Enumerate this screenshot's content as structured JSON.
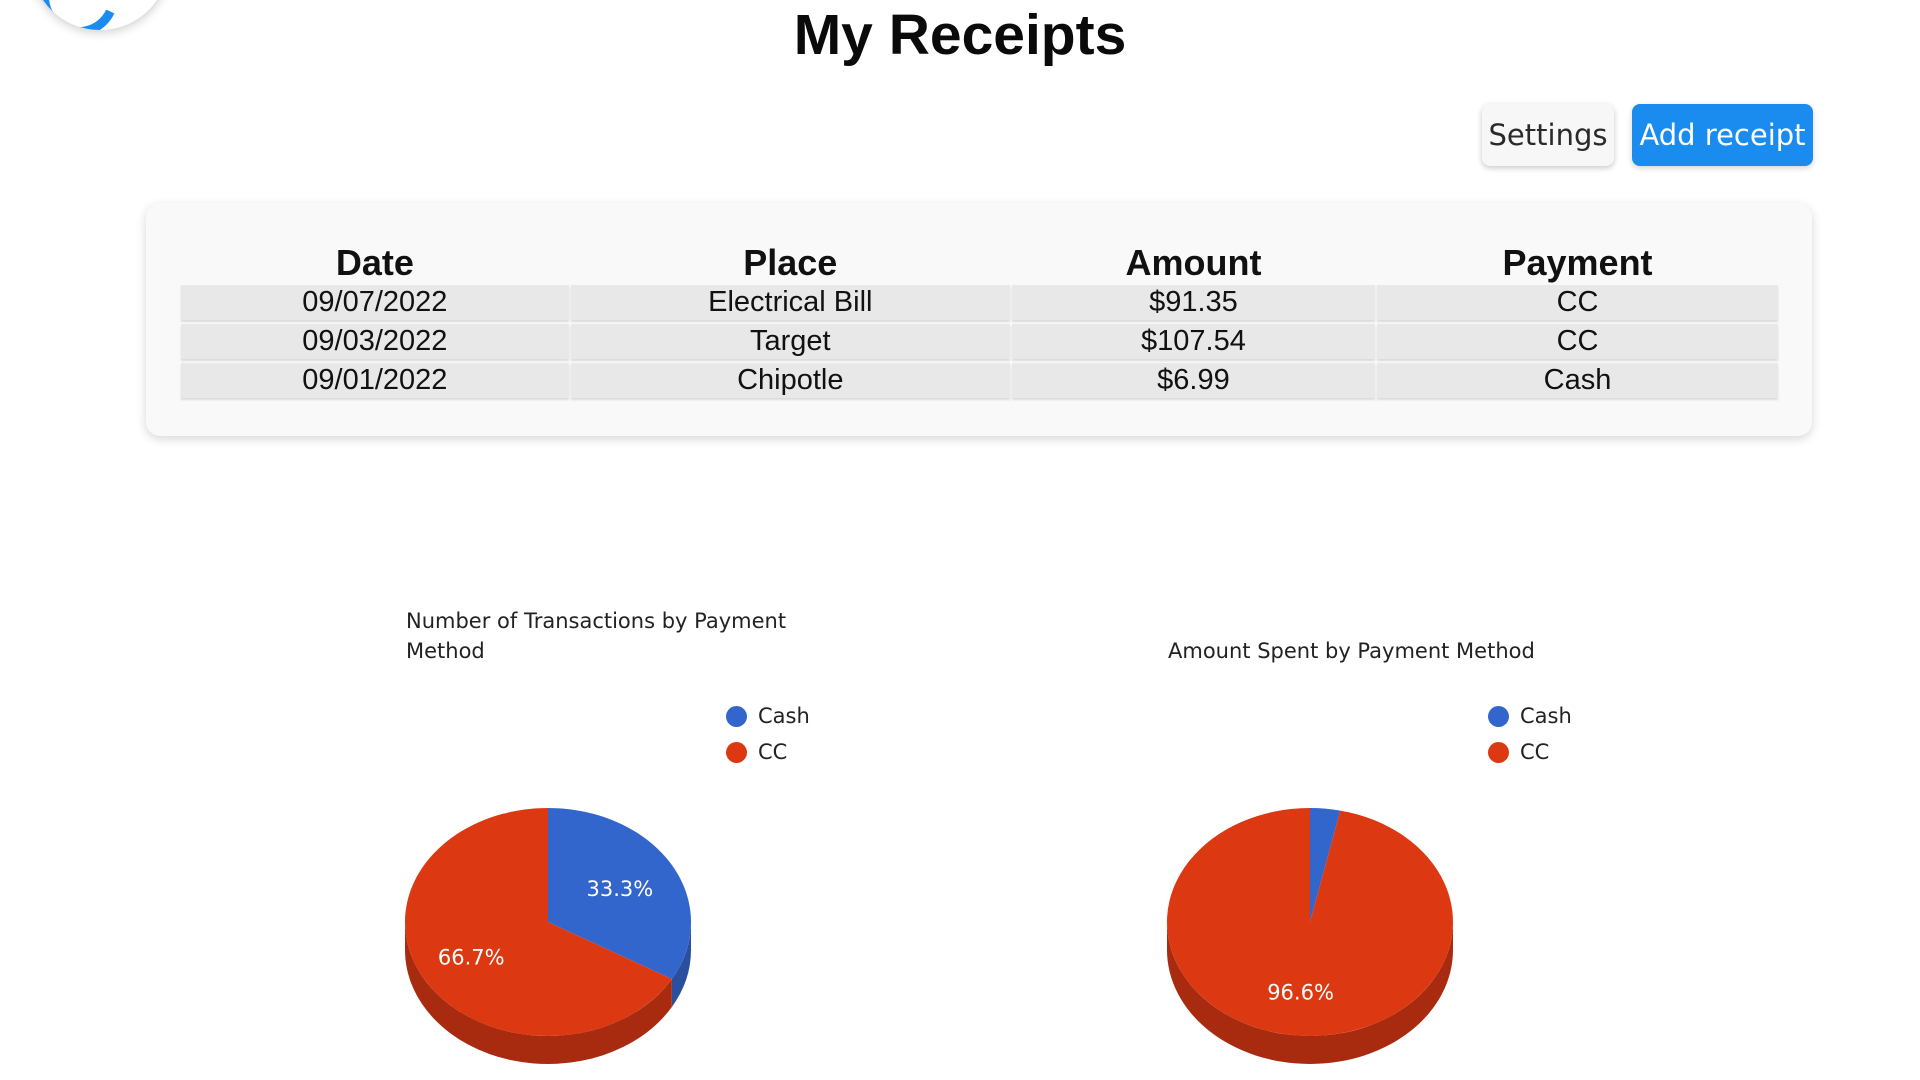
{
  "page": {
    "title": "My Receipts"
  },
  "toolbar": {
    "settings_label": "Settings",
    "add_receipt_label": "Add receipt"
  },
  "table": {
    "headers": [
      "Date",
      "Place",
      "Amount",
      "Payment"
    ],
    "rows": [
      [
        "09/07/2022",
        "Electrical Bill",
        "$91.35",
        "CC"
      ],
      [
        "09/03/2022",
        "Target",
        "$107.54",
        "CC"
      ],
      [
        "09/01/2022",
        "Chipotle",
        "$6.99",
        "Cash"
      ]
    ]
  },
  "colors": {
    "accent": "#1a8cf0",
    "cash": "#3366cc",
    "cc": "#dc3912",
    "cash_side": "#2a4f9e",
    "cc_side": "#a82b10"
  },
  "icons": {
    "avatar": "avatar-logo"
  },
  "chart_data": [
    {
      "type": "pie",
      "title": "Number of Transactions by Payment Method",
      "categories": [
        "Cash",
        "CC"
      ],
      "values": [
        1,
        2
      ],
      "data_labels": [
        "33.3%",
        "66.7%"
      ],
      "legend_position": "top-right",
      "style": "3d"
    },
    {
      "type": "pie",
      "title": "Amount Spent by Payment Method",
      "categories": [
        "Cash",
        "CC"
      ],
      "values": [
        6.99,
        198.89
      ],
      "data_labels": [
        "",
        "96.6%"
      ],
      "legend_position": "top-right",
      "style": "3d"
    }
  ]
}
